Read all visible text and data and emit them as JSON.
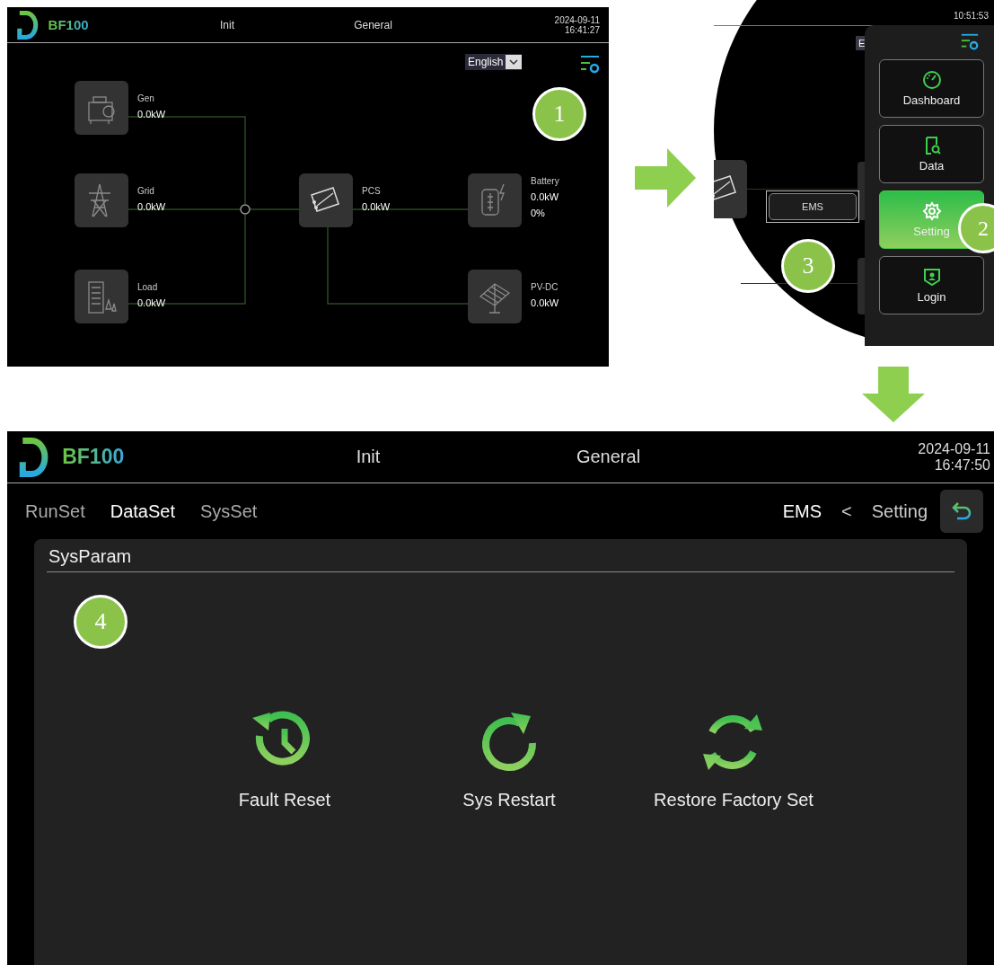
{
  "screen_1": {
    "header": {
      "brand": "BF100",
      "status": "Init",
      "mode": "General",
      "date": "2024-09-11",
      "time": "16:41:27"
    },
    "language": "English",
    "nodes": [
      {
        "kind": "generator",
        "label": "Gen",
        "values": [
          "0.0kW"
        ]
      },
      {
        "kind": "grid",
        "label": "Grid",
        "values": [
          "0.0kW"
        ]
      },
      {
        "kind": "load",
        "label": "Load",
        "values": [
          "0.0kW"
        ]
      },
      {
        "kind": "pcs",
        "label": "PCS",
        "values": [
          "0.0kW"
        ]
      },
      {
        "kind": "battery",
        "label": "Battery",
        "values": [
          "0.0kW",
          "0%"
        ]
      },
      {
        "kind": "pv",
        "label": "PV-DC",
        "values": [
          "0.0kW"
        ]
      }
    ],
    "callout": "1"
  },
  "zoom": {
    "time": "10:51:53",
    "language": "E",
    "ems_button": "EMS",
    "menu": [
      {
        "kind": "dashboard",
        "label": "Dashboard",
        "selected": false
      },
      {
        "kind": "data",
        "label": "Data",
        "selected": false
      },
      {
        "kind": "setting",
        "label": "Setting",
        "selected": true
      },
      {
        "kind": "login",
        "label": "Login",
        "selected": false
      }
    ],
    "callouts": [
      "2",
      "3"
    ]
  },
  "screen_2": {
    "header": {
      "brand": "BF100",
      "status": "Init",
      "mode": "General",
      "date": "2024-09-11",
      "time": "16:47:50"
    },
    "tabs": [
      {
        "label": "RunSet",
        "selected": false
      },
      {
        "label": "DataSet",
        "selected": true
      },
      {
        "label": "SysSet",
        "selected": false
      }
    ],
    "breadcrumb": [
      "EMS",
      "<",
      "Setting"
    ],
    "section": "SysParam",
    "actions": [
      {
        "kind": "fault_reset",
        "label": "Fault Reset"
      },
      {
        "kind": "restart",
        "label": "Sys Restart"
      },
      {
        "kind": "restore",
        "label": "Restore Factory Set"
      }
    ],
    "callout": "4"
  }
}
